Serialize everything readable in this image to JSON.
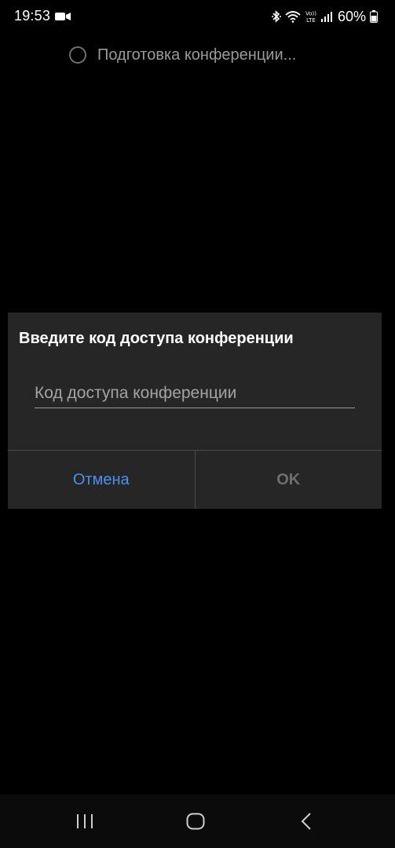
{
  "status_bar": {
    "time": "19:53",
    "battery_percent": "60%",
    "icons": [
      "video-camera-icon",
      "bluetooth-icon",
      "wifi-icon",
      "volte-icon",
      "signal-icon",
      "battery-icon"
    ]
  },
  "loading": {
    "text": "Подготовка конференции..."
  },
  "dialog": {
    "title": "Введите код доступа конференции",
    "input_placeholder": "Код доступа конференции",
    "input_value": "",
    "cancel_label": "Отмена",
    "ok_label": "OK"
  },
  "nav_bar": {
    "buttons": [
      "recents",
      "home",
      "back"
    ]
  },
  "colors": {
    "background": "#000000",
    "dialog_bg": "#262626",
    "accent": "#4f8ef0",
    "disabled": "#6e6e6e"
  }
}
